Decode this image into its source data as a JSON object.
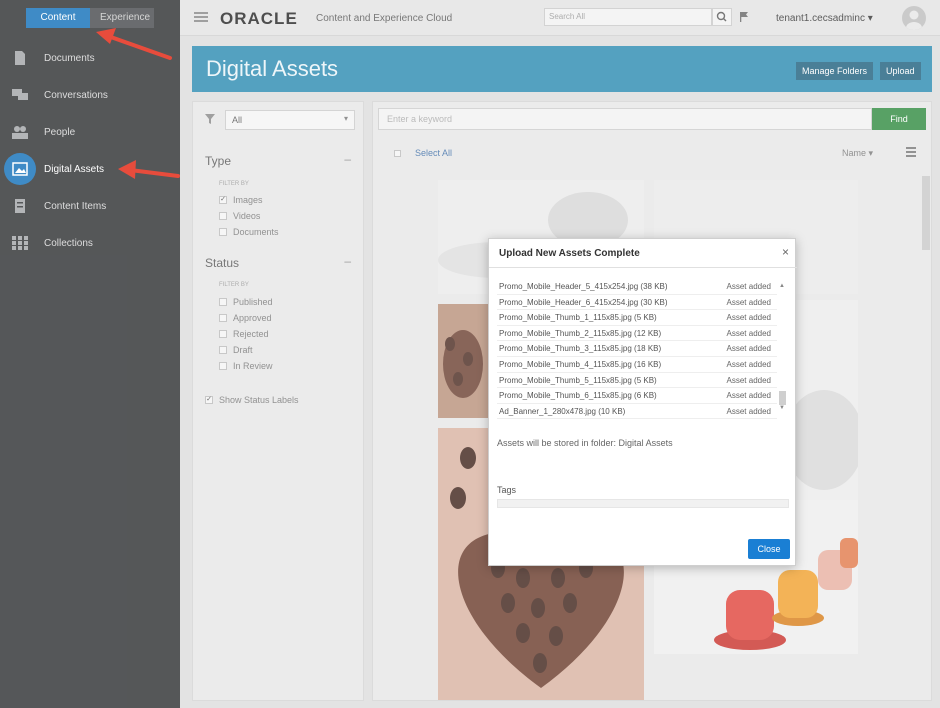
{
  "sidebar": {
    "toggle": {
      "content": "Content",
      "experience": "Experience"
    },
    "items": [
      {
        "label": "Documents",
        "icon": "document-icon"
      },
      {
        "label": "Conversations",
        "icon": "conversation-icon"
      },
      {
        "label": "People",
        "icon": "people-icon"
      },
      {
        "label": "Digital Assets",
        "icon": "image-icon",
        "active": true
      },
      {
        "label": "Content Items",
        "icon": "content-item-icon"
      },
      {
        "label": "Collections",
        "icon": "collections-icon"
      }
    ]
  },
  "topbar": {
    "logo": "ORACLE",
    "product": "Content and Experience Cloud",
    "search_placeholder": "Search All",
    "user": "tenant1.cecsadminc ▾"
  },
  "header": {
    "title": "Digital Assets",
    "manage_folders": "Manage Folders",
    "upload": "Upload"
  },
  "filters": {
    "select_value": "All",
    "type_heading": "Type",
    "type_filter_by": "FILTER BY",
    "types": [
      {
        "label": "Images",
        "checked": true
      },
      {
        "label": "Videos",
        "checked": false
      },
      {
        "label": "Documents",
        "checked": false
      }
    ],
    "status_heading": "Status",
    "status_filter_by": "FILTER BY",
    "statuses": [
      {
        "label": "Published",
        "checked": false
      },
      {
        "label": "Approved",
        "checked": false
      },
      {
        "label": "Rejected",
        "checked": false
      },
      {
        "label": "Draft",
        "checked": false
      },
      {
        "label": "In Review",
        "checked": false
      }
    ],
    "show_status_labels": "Show Status Labels"
  },
  "main": {
    "keyword_placeholder": "Enter a keyword",
    "find": "Find",
    "select_all": "Select All",
    "sort": "Name ▾"
  },
  "modal": {
    "title": "Upload New Assets Complete",
    "close_x": "×",
    "rows": [
      {
        "file": "Promo_Mobile_Header_5_415x254.jpg  (38 KB)",
        "status": "Asset added"
      },
      {
        "file": "Promo_Mobile_Header_6_415x254.jpg  (30 KB)",
        "status": "Asset added"
      },
      {
        "file": "Promo_Mobile_Thumb_1_115x85.jpg  (5 KB)",
        "status": "Asset added"
      },
      {
        "file": "Promo_Mobile_Thumb_2_115x85.jpg  (12 KB)",
        "status": "Asset added"
      },
      {
        "file": "Promo_Mobile_Thumb_3_115x85.jpg  (18 KB)",
        "status": "Asset added"
      },
      {
        "file": "Promo_Mobile_Thumb_4_115x85.jpg  (16 KB)",
        "status": "Asset added"
      },
      {
        "file": "Promo_Mobile_Thumb_5_115x85.jpg  (5 KB)",
        "status": "Asset added"
      },
      {
        "file": "Promo_Mobile_Thumb_6_115x85.jpg  (6 KB)",
        "status": "Asset added"
      },
      {
        "file": "Ad_Banner_1_280x478.jpg  (10 KB)",
        "status": "Asset added"
      }
    ],
    "folder_text": "Assets will be stored in folder: Digital Assets",
    "tags_label": "Tags",
    "close_button": "Close"
  },
  "colors": {
    "accent": "#0f6fb8",
    "band": "#2a8ab1",
    "find": "#2f8a3f",
    "close": "#1a7fd4",
    "annotation": "#e74c3c"
  }
}
